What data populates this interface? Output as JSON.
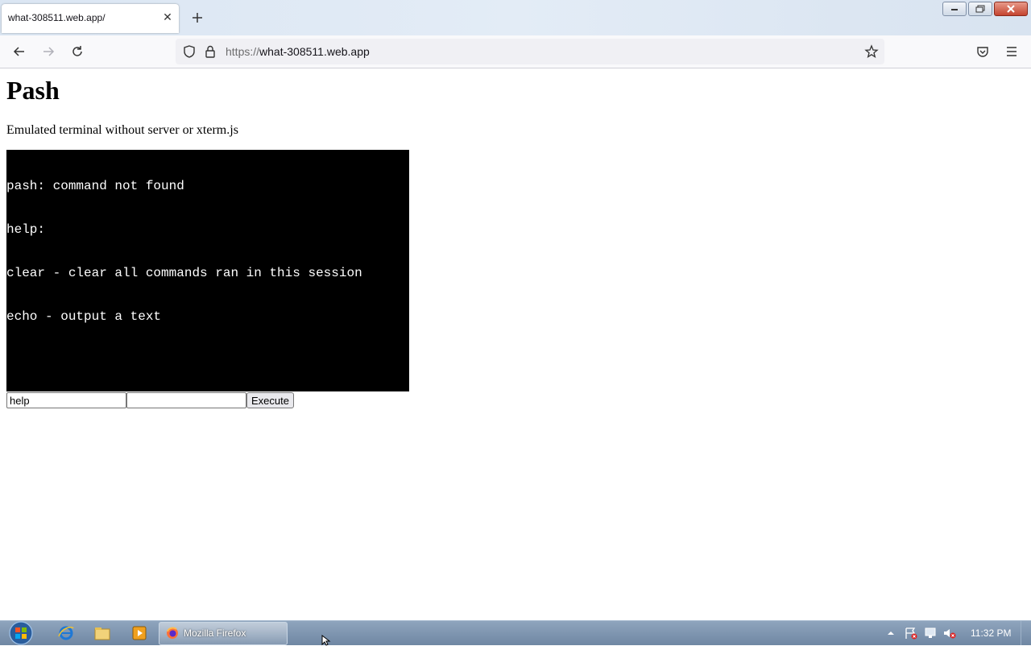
{
  "browser": {
    "tab_title": "what-308511.web.app/",
    "url_scheme": "https://",
    "url_host": "what-308511.web.app"
  },
  "page": {
    "title": "Pash",
    "subtitle": "Emulated terminal without server or xterm.js",
    "terminal_lines": [
      "pash: command not found",
      "help:",
      "clear - clear all commands ran in this session",
      "echo - output a text"
    ],
    "command_input_value": "help",
    "arg_input_value": "",
    "execute_label": "Execute"
  },
  "taskbar": {
    "active_task_label": "Mozilla Firefox",
    "clock": "11:32 PM"
  },
  "colors": {
    "terminal_bg": "#000000",
    "terminal_fg": "#ffffff",
    "taskbar": "#7f96b1"
  }
}
